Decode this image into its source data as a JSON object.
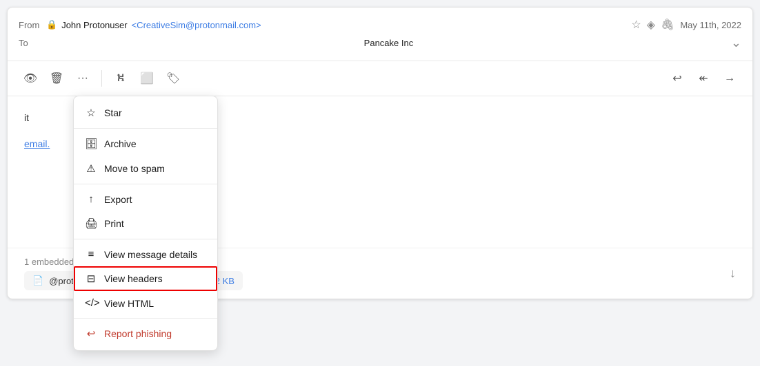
{
  "email": {
    "from_label": "From",
    "to_label": "To",
    "sender_name": "John Protonuser",
    "sender_email": "<CreativeSim@protonmail.com>",
    "recipient": "Pancake Inc",
    "date": "May 11th, 2022",
    "body_text_1": "it",
    "body_text_2": "email."
  },
  "toolbar": {
    "more_label": "···"
  },
  "attachment": {
    "section_label": "1 embedded image",
    "file_name": "@protonmail.com - 0x04A50628.asc",
    "file_size": "1.82 KB"
  },
  "menu": {
    "star": "Star",
    "archive": "Archive",
    "move_to_spam": "Move to spam",
    "export": "Export",
    "print": "Print",
    "view_message_details": "View message details",
    "view_headers": "View headers",
    "view_html": "View HTML",
    "report_phishing": "Report phishing"
  }
}
